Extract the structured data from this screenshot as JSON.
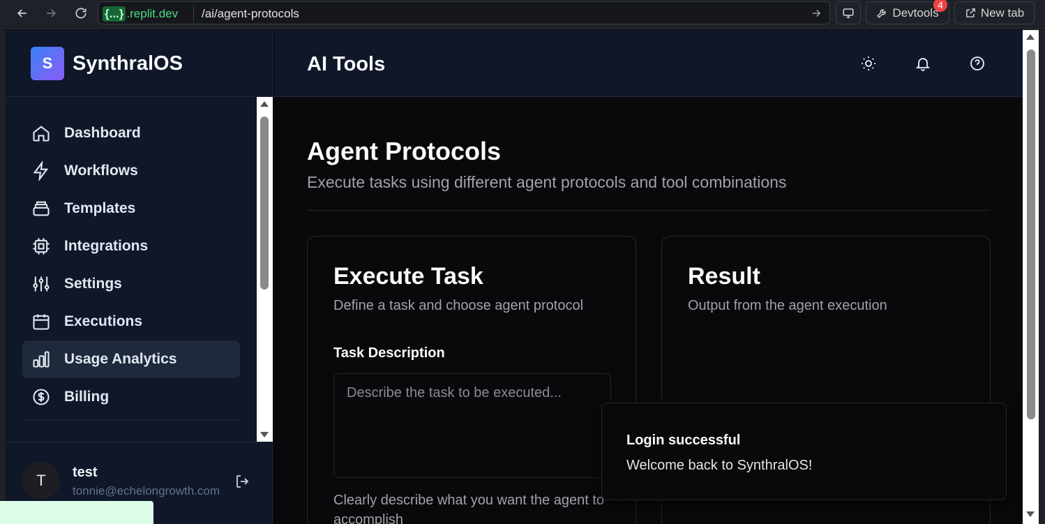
{
  "browser": {
    "host_brace": "{...}",
    "host": ".replit.dev",
    "path": "/ai/agent-protocols",
    "devtools_label": "Devtools",
    "devtools_badge": "4",
    "newtab_label": "New tab"
  },
  "brand": {
    "logo_letter": "S",
    "name": "SynthralOS"
  },
  "sidebar": {
    "items": [
      {
        "label": "Dashboard",
        "icon": "home-icon"
      },
      {
        "label": "Workflows",
        "icon": "lightning-icon"
      },
      {
        "label": "Templates",
        "icon": "layers-icon"
      },
      {
        "label": "Integrations",
        "icon": "chip-icon"
      },
      {
        "label": "Settings",
        "icon": "sliders-icon"
      },
      {
        "label": "Executions",
        "icon": "calendar-icon"
      },
      {
        "label": "Usage Analytics",
        "icon": "bar-chart-icon",
        "active": true
      },
      {
        "label": "Billing",
        "icon": "dollar-circle-icon"
      }
    ]
  },
  "user": {
    "initial": "T",
    "name": "test",
    "email": "tonnie@echelongrowth.com"
  },
  "header": {
    "title": "AI Tools"
  },
  "main": {
    "title": "Agent Protocols",
    "subtitle": "Execute tasks using different agent protocols and tool combinations",
    "execute_card": {
      "title": "Execute Task",
      "subtitle": "Define a task and choose agent protocol",
      "field_label": "Task Description",
      "placeholder": "Describe the task to be executed...",
      "hint": "Clearly describe what you want the agent to accomplish"
    },
    "result_card": {
      "title": "Result",
      "subtitle": "Output from the agent execution"
    }
  },
  "toast": {
    "title": "Login successful",
    "message": "Welcome back to SynthralOS!"
  },
  "colors": {
    "accent_gradient_start": "#3b82f6",
    "accent_gradient_end": "#8b5cf6",
    "sidebar_bg": "#0f1729",
    "main_bg": "#09090b",
    "badge": "#ef4444"
  }
}
